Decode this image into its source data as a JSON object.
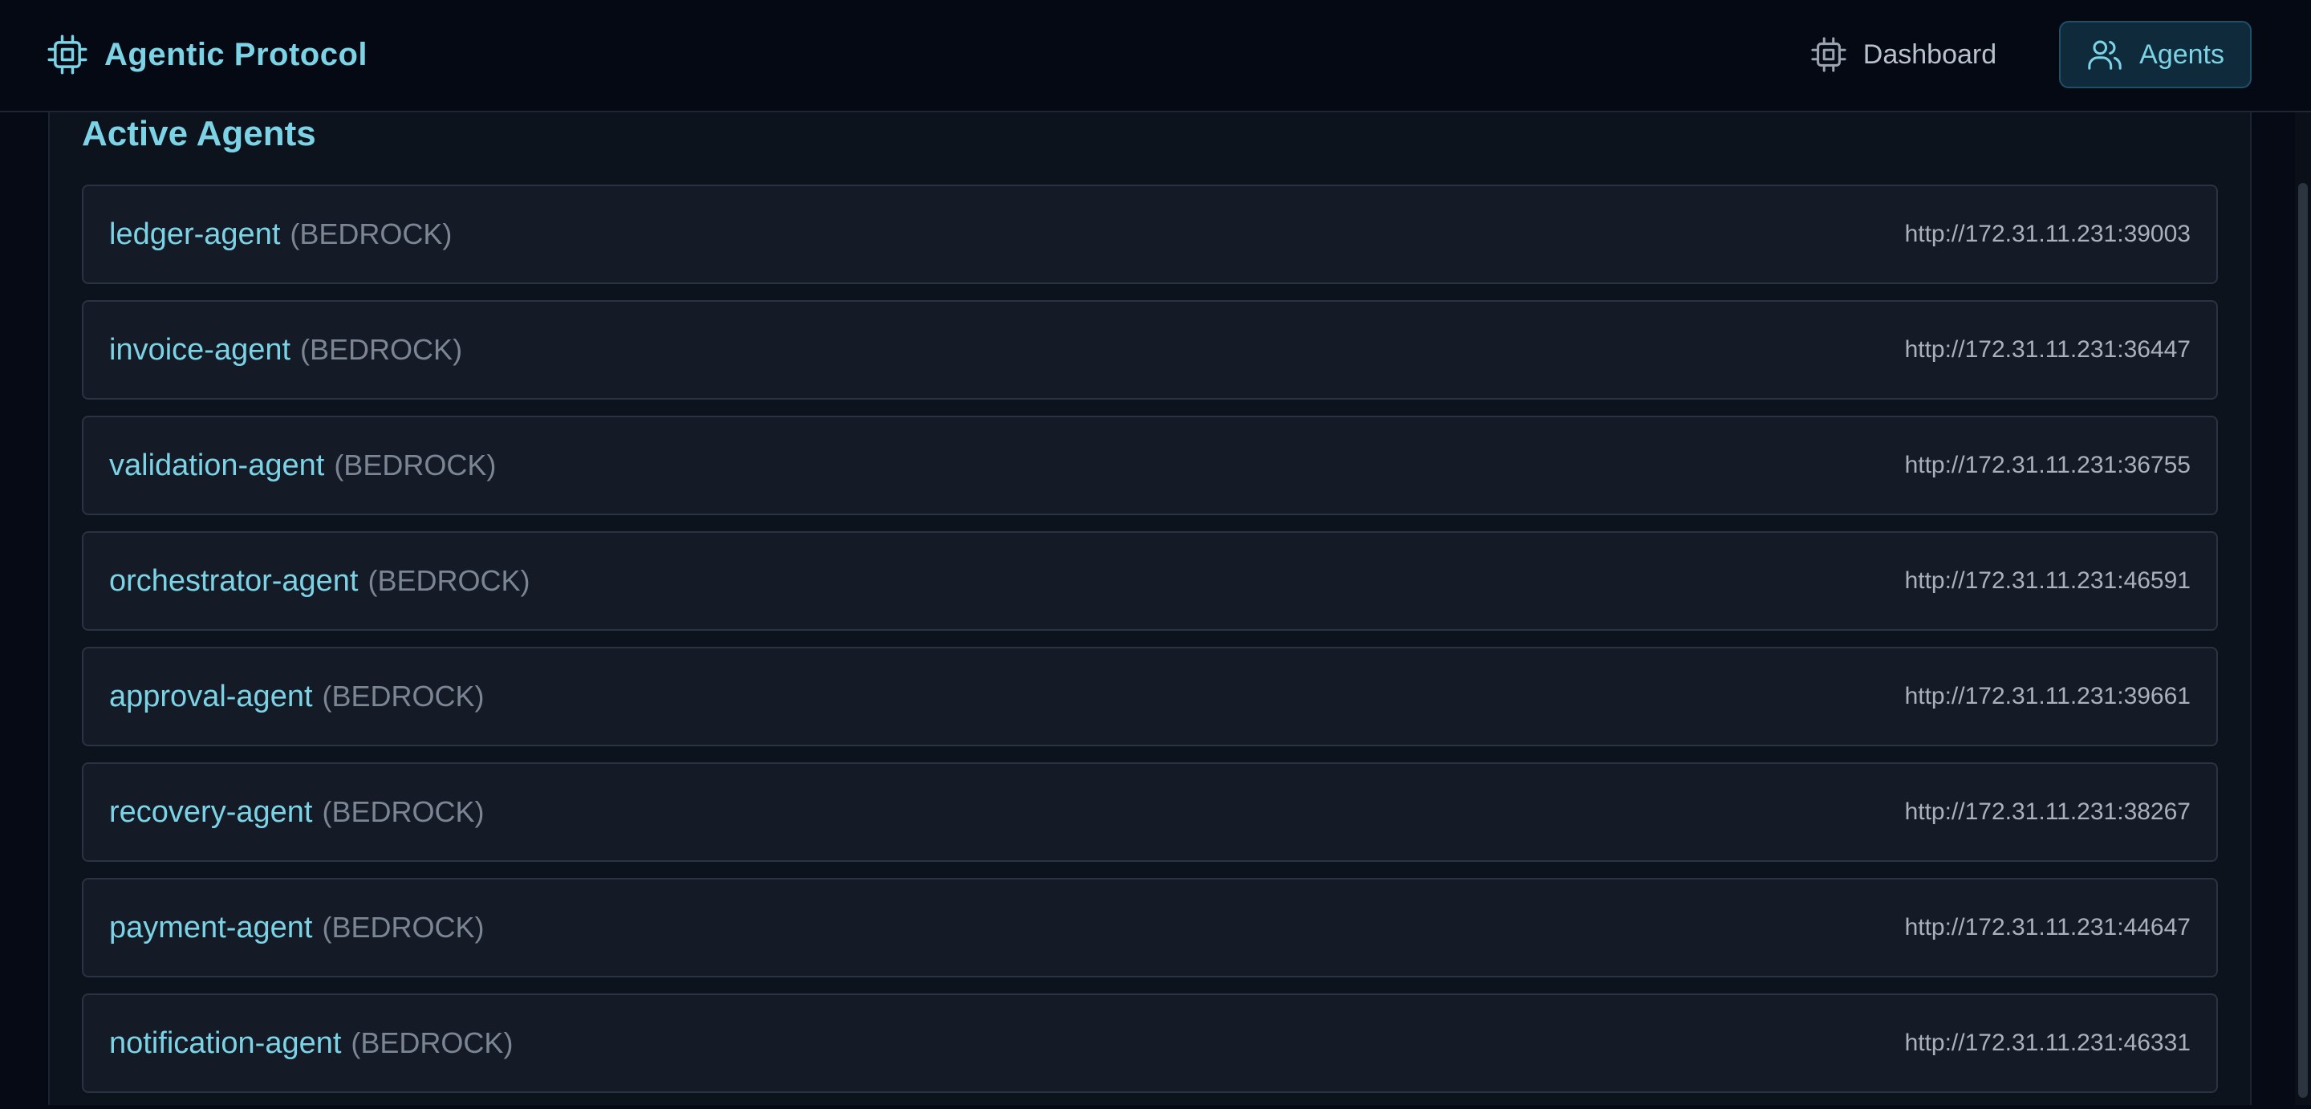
{
  "app": {
    "title": "Agentic Protocol",
    "logo_icon": "cpu-chip-icon"
  },
  "nav": {
    "items": [
      {
        "label": "Dashboard",
        "icon": "cpu-chip-icon",
        "active": false
      },
      {
        "label": "Agents",
        "icon": "users-icon",
        "active": true
      }
    ]
  },
  "main": {
    "section_title": "Active Agents",
    "agents": [
      {
        "name": "ledger-agent",
        "provider": "(BEDROCK)",
        "url": "http://172.31.11.231:39003"
      },
      {
        "name": "invoice-agent",
        "provider": "(BEDROCK)",
        "url": "http://172.31.11.231:36447"
      },
      {
        "name": "validation-agent",
        "provider": "(BEDROCK)",
        "url": "http://172.31.11.231:36755"
      },
      {
        "name": "orchestrator-agent",
        "provider": "(BEDROCK)",
        "url": "http://172.31.11.231:46591"
      },
      {
        "name": "approval-agent",
        "provider": "(BEDROCK)",
        "url": "http://172.31.11.231:39661"
      },
      {
        "name": "recovery-agent",
        "provider": "(BEDROCK)",
        "url": "http://172.31.11.231:38267"
      },
      {
        "name": "payment-agent",
        "provider": "(BEDROCK)",
        "url": "http://172.31.11.231:44647"
      },
      {
        "name": "notification-agent",
        "provider": "(BEDROCK)",
        "url": "http://172.31.11.231:46331"
      }
    ]
  },
  "colors": {
    "accent": "#7dd3e6",
    "background": "#050a14",
    "panel": "#0d131d",
    "row": "#141b26",
    "muted_text": "#7b8593"
  }
}
